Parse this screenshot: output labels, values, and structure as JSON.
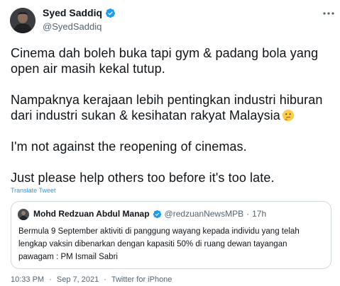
{
  "author": {
    "display_name": "Syed Saddiq",
    "handle": "@SyedSaddiq"
  },
  "tweet": {
    "paragraphs": [
      "Cinema dah boleh buka tapi gym & padang bola yang open air masih kekal tutup.",
      "Nampaknya kerajaan lebih pentingkan industri hiburan dari industri sukan & kesihatan rakyat Malaysia",
      "I'm not against the reopening of cinemas.",
      "Just please help others too before it's too late."
    ],
    "emoji": "thinking-face-icon"
  },
  "translate_label": "Translate Tweet",
  "quoted": {
    "display_name": "Mohd Redzuan Abdul Manap",
    "handle": "@redzuanNewsMPB",
    "separator": "·",
    "time": "17h",
    "text": "Bermula 9 September aktiviti di panggung wayang kepada individu yang telah lengkap vaksin dibenarkan dengan kapasiti 50% di ruang dewan tayangan pawagam : PM Ismail Sabri"
  },
  "footer": {
    "time": "10:33 PM",
    "sep1": "·",
    "date": "Sep 7, 2021",
    "sep2": "·",
    "source": "Twitter for iPhone"
  },
  "colors": {
    "link": "#1d9bf0",
    "secondary_text": "#536471",
    "verified": "#1d9bf0"
  }
}
